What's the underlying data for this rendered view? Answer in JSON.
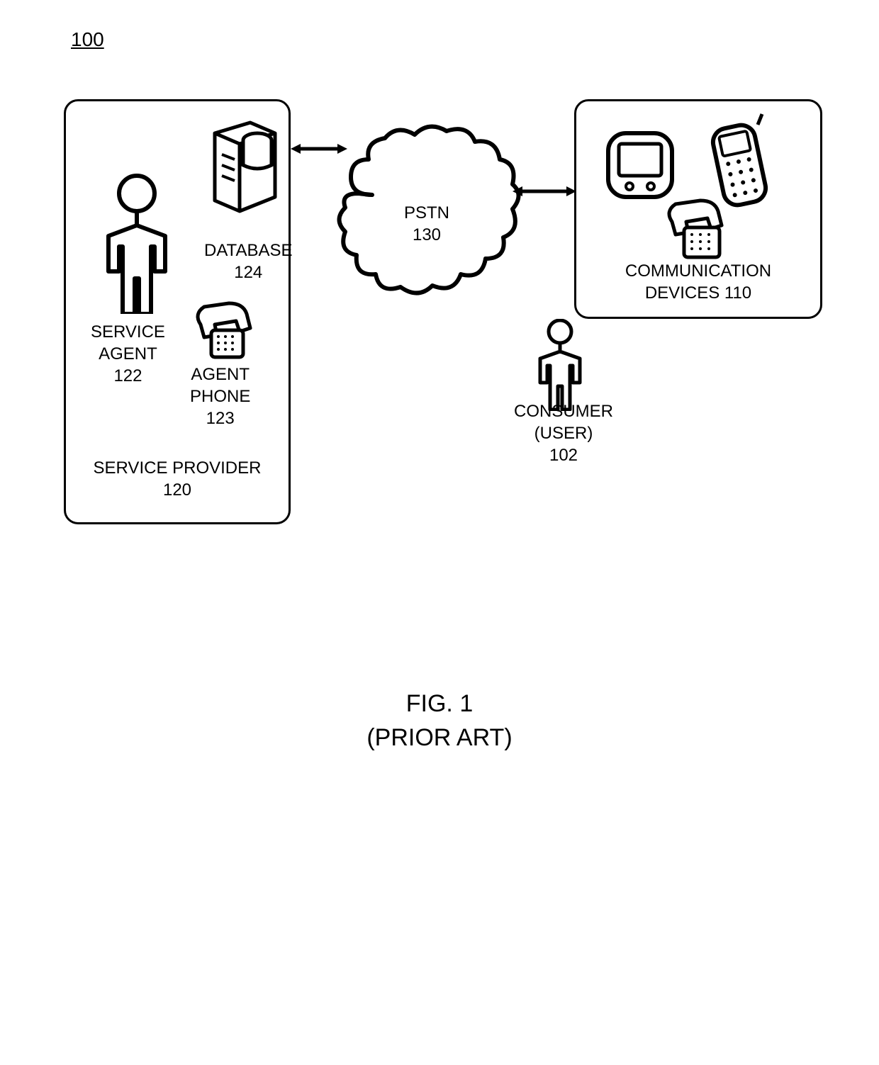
{
  "reference_number": "100",
  "service_provider": {
    "label": "SERVICE PROVIDER",
    "number": "120"
  },
  "service_agent": {
    "label": "SERVICE",
    "label2": "AGENT",
    "number": "122"
  },
  "database": {
    "label": "DATABASE",
    "number": "124"
  },
  "agent_phone": {
    "label": "AGENT",
    "label2": "PHONE",
    "number": "123"
  },
  "pstn": {
    "label": "PSTN",
    "number": "130"
  },
  "consumer": {
    "label": "CONSUMER",
    "label2": "(USER)",
    "number": "102"
  },
  "comm_devices": {
    "label": "COMMUNICATION",
    "label2": "DEVICES",
    "number": "110"
  },
  "figure": {
    "label": "FIG. 1",
    "subtitle": "(PRIOR ART)"
  }
}
